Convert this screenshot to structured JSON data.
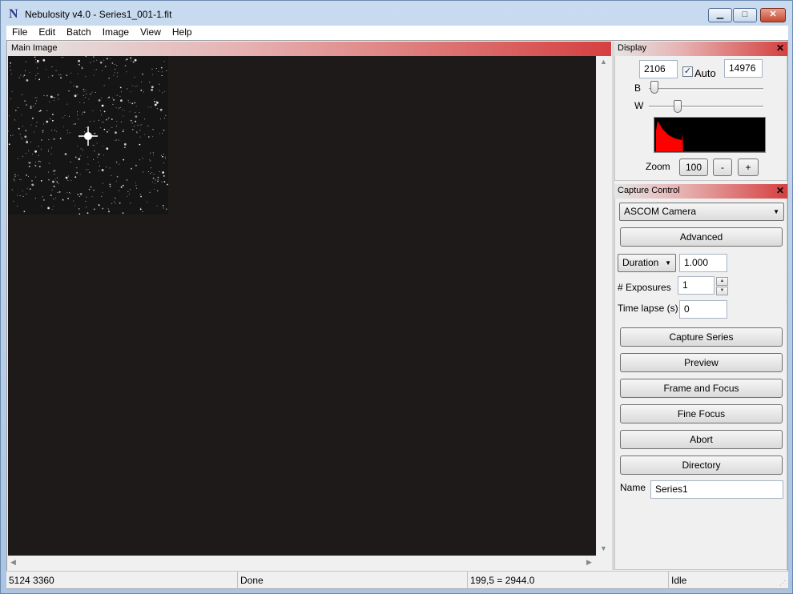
{
  "window": {
    "title": "Nebulosity v4.0 - Series1_001-1.fit",
    "app_icon_glyph": "N",
    "minimize_glyph": "▁",
    "maximize_glyph": "□",
    "close_glyph": "✕"
  },
  "menu": [
    "File",
    "Edit",
    "Batch",
    "Image",
    "View",
    "Help"
  ],
  "main_image": {
    "title": "Main Image"
  },
  "display": {
    "title": "Display",
    "close_glyph": "✕",
    "black_value": "2106",
    "white_value": "14976",
    "auto_label": "Auto",
    "auto_checked": true,
    "auto_check_glyph": "✓",
    "b_label": "B",
    "w_label": "W",
    "b_slider_level": 0.05,
    "w_slider_level": 0.25,
    "zoom_label": "Zoom",
    "zoom_value": "100",
    "zoom_out_label": "-",
    "zoom_in_label": "+"
  },
  "capture": {
    "title": "Capture Control",
    "close_glyph": "✕",
    "camera": "ASCOM Camera",
    "advanced_label": "Advanced",
    "duration_mode": "Duration",
    "duration_value": "1.000",
    "exposures_label": "# Exposures",
    "exposures_value": "1",
    "timelapse_label": "Time lapse (s)",
    "timelapse_value": "0",
    "buttons": {
      "capture_series": "Capture Series",
      "preview": "Preview",
      "frame_focus": "Frame and Focus",
      "fine_focus": "Fine Focus",
      "abort": "Abort",
      "directory": "Directory"
    },
    "name_label": "Name",
    "name_value": "Series1"
  },
  "status": {
    "dimensions": "5124 3360",
    "message": "Done",
    "pixel_readout": "199,5 = 2944.0",
    "state": "Idle"
  },
  "colors": {
    "panel_title_accent": "#d54040",
    "image_background": "#1e1a1a",
    "histogram_fill": "#ff0000"
  }
}
